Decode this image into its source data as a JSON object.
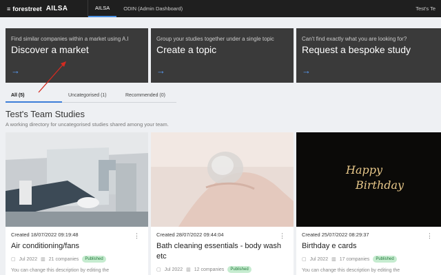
{
  "nav": {
    "brand_mark": "≡",
    "brand_name": "forestreet",
    "app_name": "AILSA",
    "tabs": [
      {
        "label": "AILSA",
        "active": true
      },
      {
        "label": "ODIN (Admin Dashboard)",
        "active": false
      }
    ],
    "user": "Test's Te"
  },
  "actions": [
    {
      "small": "Find similar companies within a market using A.I",
      "big": "Discover a market",
      "arrow": "→"
    },
    {
      "small": "Group your studies together under a single topic",
      "big": "Create a topic",
      "arrow": "→"
    },
    {
      "small": "Can't find exactly what you are looking for?",
      "big": "Request a bespoke study",
      "arrow": "→"
    }
  ],
  "tabs": [
    {
      "label": "All (5)",
      "active": true
    },
    {
      "label": "Uncategorised (1)",
      "active": false
    },
    {
      "label": "Recommended (0)",
      "active": false
    }
  ],
  "section": {
    "title": "Test's Team Studies",
    "subtitle": "A working directory for uncategorised studies shared among your team."
  },
  "studies": [
    {
      "created": "Created 18/07/2022 09:19:48",
      "title": "Air conditioning/fans",
      "date": "Jul 2022",
      "companies": "21 companies",
      "status": "Published",
      "desc": "You can change this description by editing the"
    },
    {
      "created": "Created 28/07/2022 09:44:04",
      "title": "Bath cleaning essentials - body wash etc",
      "date": "Jul 2022",
      "companies": "12 companies",
      "status": "Published",
      "desc": "You can change this description by editing the"
    },
    {
      "created": "Created 25/07/2022 08:29:37",
      "title": "Birthday e cards",
      "date": "Jul 2022",
      "companies": "17 companies",
      "status": "Published",
      "desc": "You can change this description by editing the"
    }
  ],
  "image_text": {
    "birthday_line1": "Happy",
    "birthday_line2": "Birthday"
  },
  "icons": {
    "calendar": "calendar-icon",
    "companies": "building-icon",
    "kebab": "more-vertical-icon"
  },
  "colors": {
    "nav_bg": "#1f1f1f",
    "card_bg": "#3a3a3a",
    "accent": "#4a90e2",
    "badge_bg": "#c6ecd0",
    "badge_text": "#237a3a",
    "annotation": "#d62a20"
  }
}
